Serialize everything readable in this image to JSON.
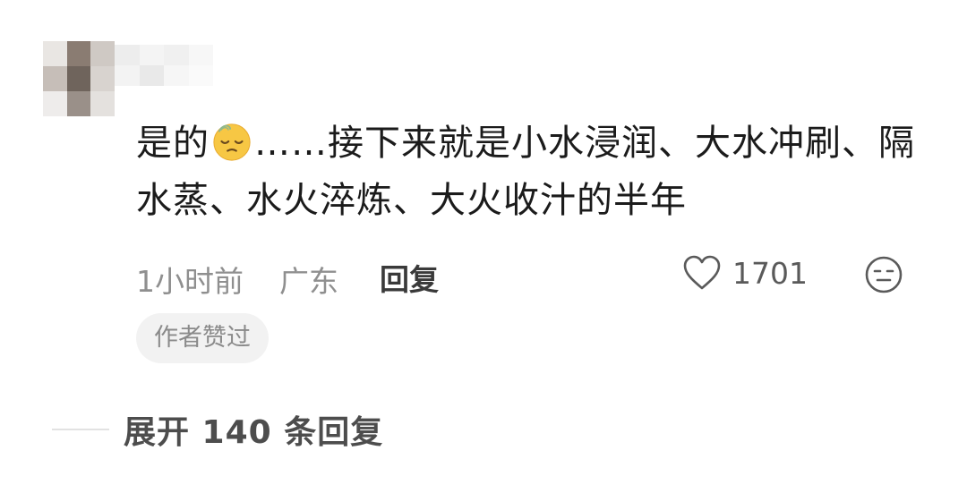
{
  "comment": {
    "text_before_emoji": "是的",
    "text_after_emoji": "……接下来就是小水浸润、大水冲刷、隔水蒸、水火淬炼、大火收汁的半年",
    "emoji_icon": "pensive-face-icon",
    "time": "1小时前",
    "location": "广东",
    "reply_label": "回复",
    "like_count": "1701",
    "author_badge": "作者赞过"
  },
  "replies": {
    "expand_label": "展开 140 条回复"
  },
  "colors": {
    "text": "#1b1b1b",
    "meta": "#8f8f8f",
    "badge_bg": "#f2f2f2",
    "emoji_yellow": "#f7c744"
  }
}
